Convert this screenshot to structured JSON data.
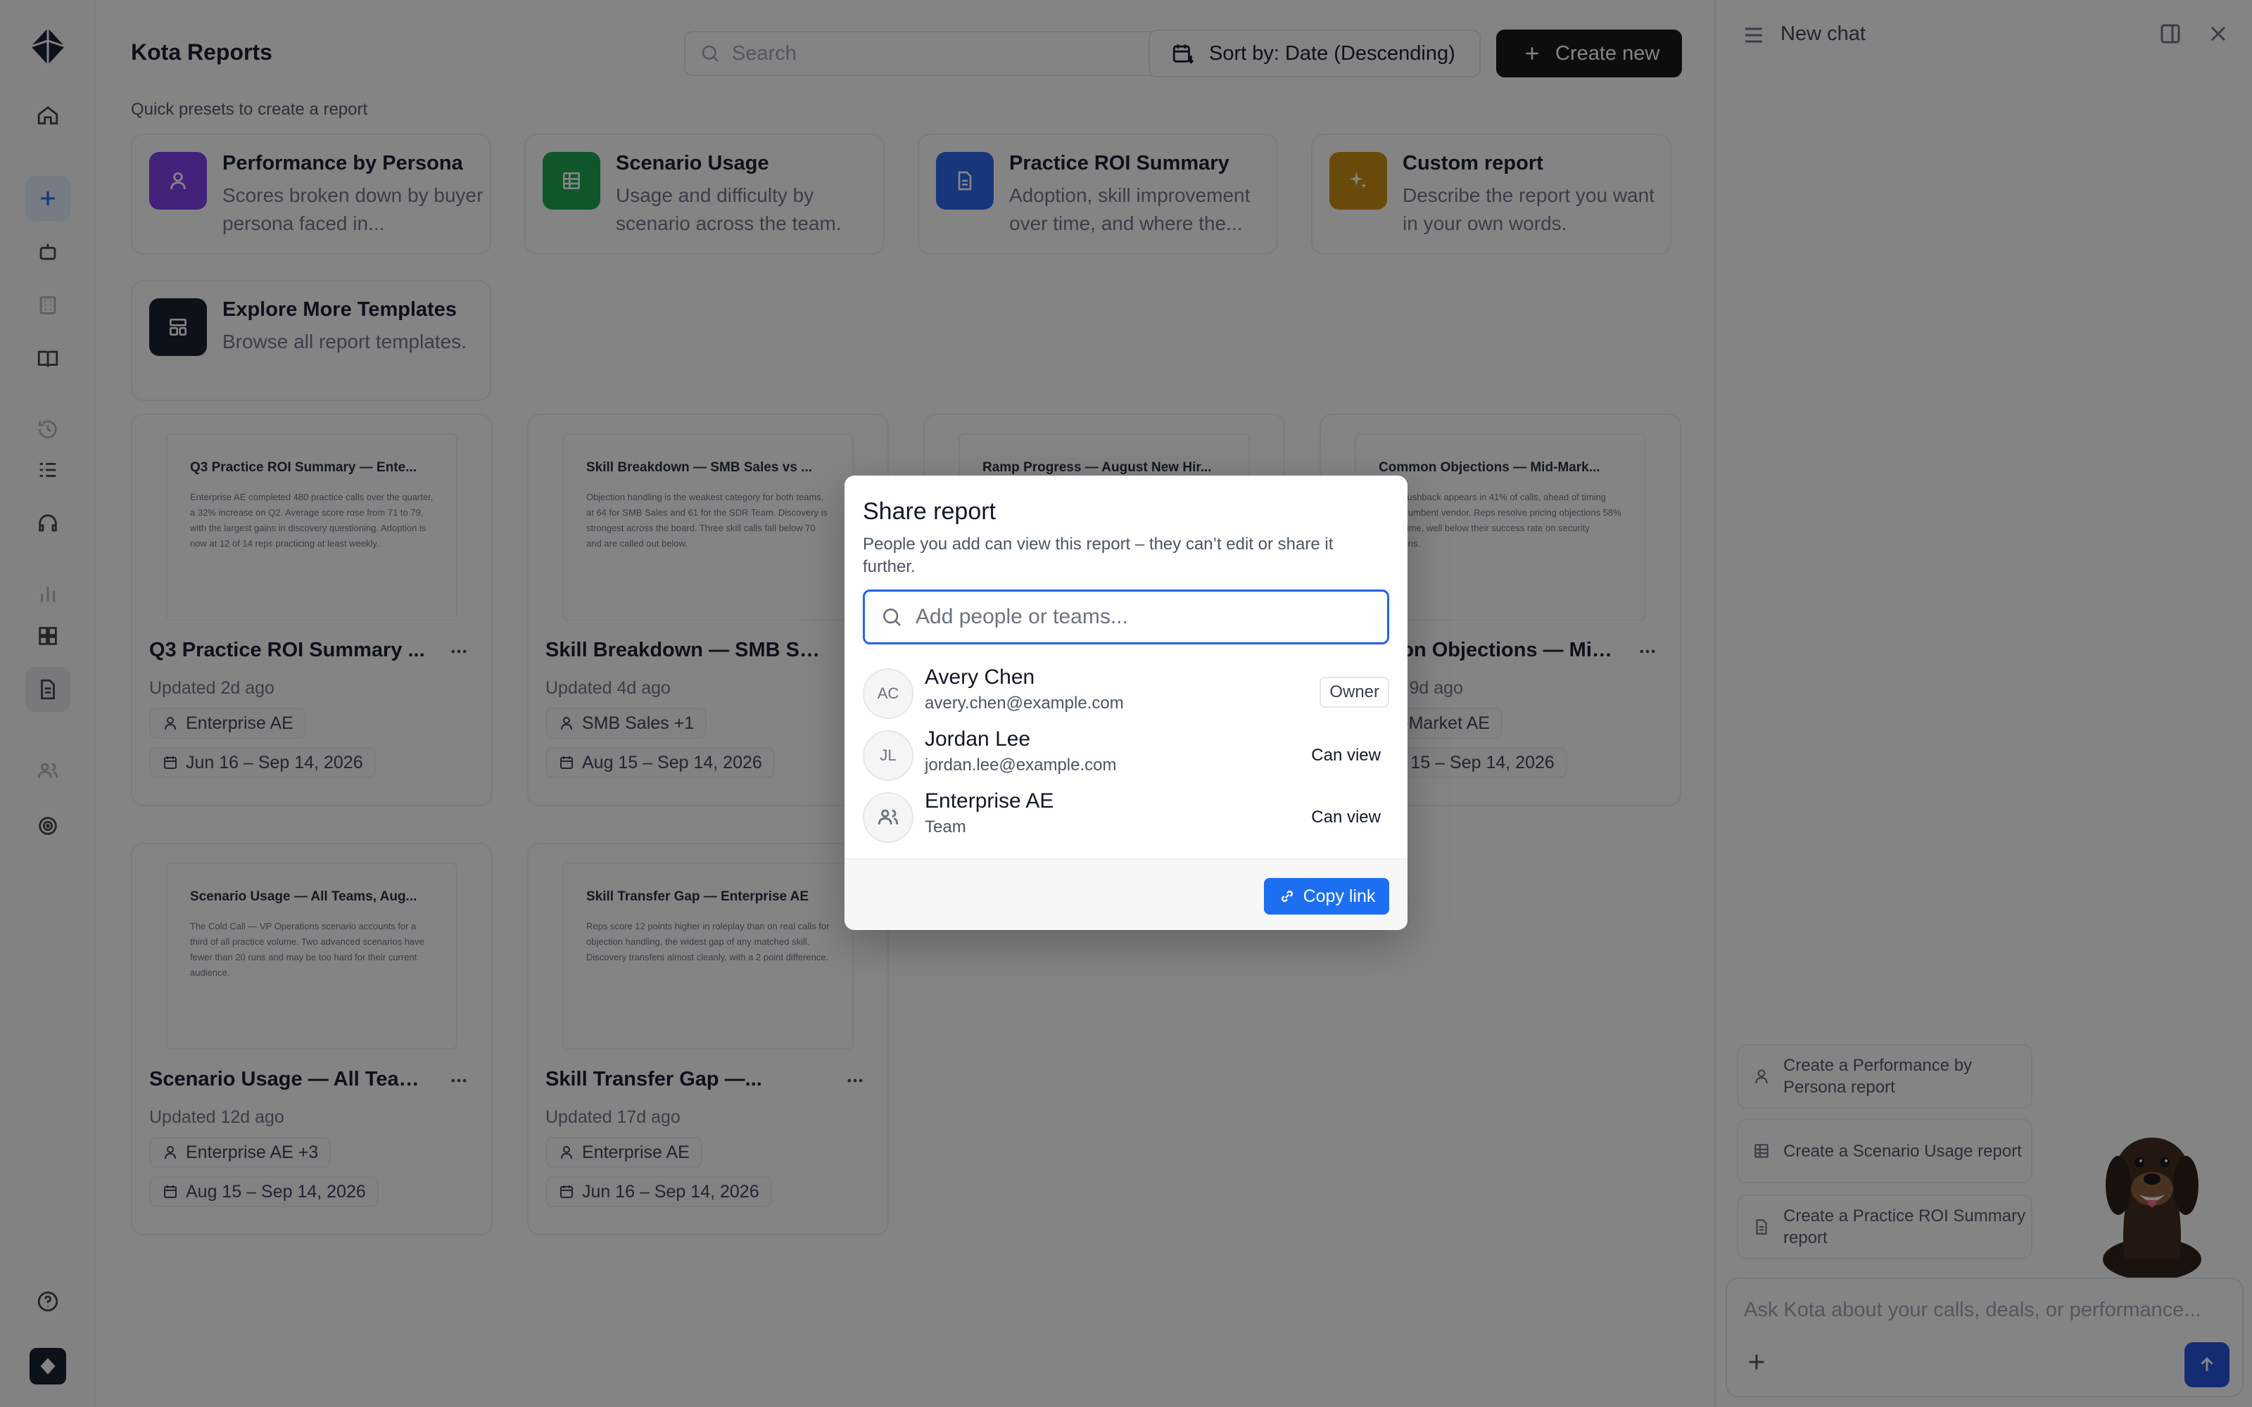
{
  "app": {
    "title": "Kota Reports",
    "search_placeholder": "Search",
    "sort_label": "Sort by: Date (Descending)",
    "create_label": "Create new",
    "presets_label": "Quick presets to create a report"
  },
  "rail": {
    "icons": [
      "kota-logo-icon",
      "home-icon",
      "plus-icon",
      "bot-icon",
      "building-icon",
      "book-icon",
      "history-icon",
      "list-icon",
      "headset-icon",
      "bar-chart-icon",
      "grid-icon",
      "report-icon",
      "people-icon",
      "target-icon",
      "help-icon"
    ]
  },
  "presets": [
    {
      "title": "Performance by Persona",
      "desc": "Scores broken down by buyer persona faced in...",
      "icon": "person-icon",
      "color": "#7c3aed"
    },
    {
      "title": "Scenario Usage",
      "desc": "Usage and difficulty by scenario across the team.",
      "icon": "table-icon",
      "color": "#16a34a"
    },
    {
      "title": "Practice ROI Summary",
      "desc": "Adoption, skill improvement over time, and where the...",
      "icon": "document-icon",
      "color": "#2563eb"
    },
    {
      "title": "Custom report",
      "desc": "Describe the report you want in your own words.",
      "icon": "sparkle-icon",
      "color": "#ca8a04"
    },
    {
      "title": "Explore More Templates",
      "desc": "Browse all report templates.",
      "icon": "templates-icon",
      "color": "#111827"
    }
  ],
  "reports": [
    {
      "thumb_title": "Q3 Practice ROI Summary — Ente...",
      "thumb_body": "Enterprise AE completed 480 practice calls over the quarter, a 32% increase on Q2. Average score rose from 71 to 79, with the largest gains in discovery questioning. Adoption is now at 12 of 14 reps practicing at least weekly.",
      "title": "Q3 Practice ROI Summary ...",
      "updated": "Updated 2d ago",
      "tag": "Enterprise AE",
      "dates": "Jun 16 – Sep 14, 2026"
    },
    {
      "thumb_title": "Skill Breakdown — SMB Sales vs ...",
      "thumb_body": "Objection handling is the weakest category for both teams, at 64 for SMB Sales and 61 for the SDR Team. Discovery is strongest across the board. Three skill calls fall below 70 and are called out below.",
      "title": "Skill Breakdown — SMB Sal...",
      "updated": "Updated 4d ago",
      "tag": "SMB Sales +1",
      "dates": "Aug 15 – Sep 14, 2026"
    },
    {
      "thumb_title": "Ramp Progress — August New Hir...",
      "thumb_body": "",
      "title": "",
      "updated": "",
      "tag": "",
      "dates": ""
    },
    {
      "thumb_title": "Common Objections — Mid-Mark...",
      "thumb_body": "Price pushback appears in 41% of calls, ahead of timing and incumbent vendor. Reps resolve pricing objections 58% of the time, well below their success rate on security questions.",
      "title": "Common Objections — Mid...",
      "updated": "Updated 9d ago",
      "tag": "Mid-Market AE",
      "dates": "Aug 15 – Sep 14, 2026"
    },
    {
      "thumb_title": "Scenario Usage — All Teams, Aug...",
      "thumb_body": "The Cold Call — VP Operations scenario accounts for a third of all practice volume. Two advanced scenarios have fewer than 20 runs and may be too hard for their current audience.",
      "title": "Scenario Usage — All Team...",
      "updated": "Updated 12d ago",
      "tag": "Enterprise AE +3",
      "dates": "Aug 15 – Sep 14, 2026"
    },
    {
      "thumb_title": "Skill Transfer Gap — Enterprise AE",
      "thumb_body": "Reps score 12 points higher in roleplay than on real calls for objection handling, the widest gap of any matched skill. Discovery transfers almost cleanly, with a 2 point difference.",
      "title": "Skill Transfer Gap —...",
      "updated": "Updated 17d ago",
      "tag": "Enterprise AE",
      "dates": "Jun 16 – Sep 14, 2026"
    }
  ],
  "chat": {
    "title": "New chat",
    "suggestions": [
      {
        "text": "Create a Performance by Persona report",
        "icon": "person-icon"
      },
      {
        "text": "Create a Scenario Usage report",
        "icon": "table-icon"
      },
      {
        "text": "Create a Practice ROI Summary report",
        "icon": "document-icon"
      }
    ],
    "input_placeholder": "Ask Kota about your calls, deals, or performance..."
  },
  "modal": {
    "title": "Share report",
    "description": "People you add can view this report – they can’t edit or share it further.",
    "search_placeholder": "Add people or teams...",
    "people": [
      {
        "initials": "AC",
        "name": "Avery Chen",
        "sub": "avery.chen@example.com",
        "role": "Owner"
      },
      {
        "initials": "JL",
        "name": "Jordan Lee",
        "sub": "jordan.lee@example.com",
        "role": "Can view"
      },
      {
        "initials": "",
        "name": "Enterprise AE",
        "sub": "Team",
        "role": "Can view"
      }
    ],
    "copy_label": "Copy link"
  }
}
